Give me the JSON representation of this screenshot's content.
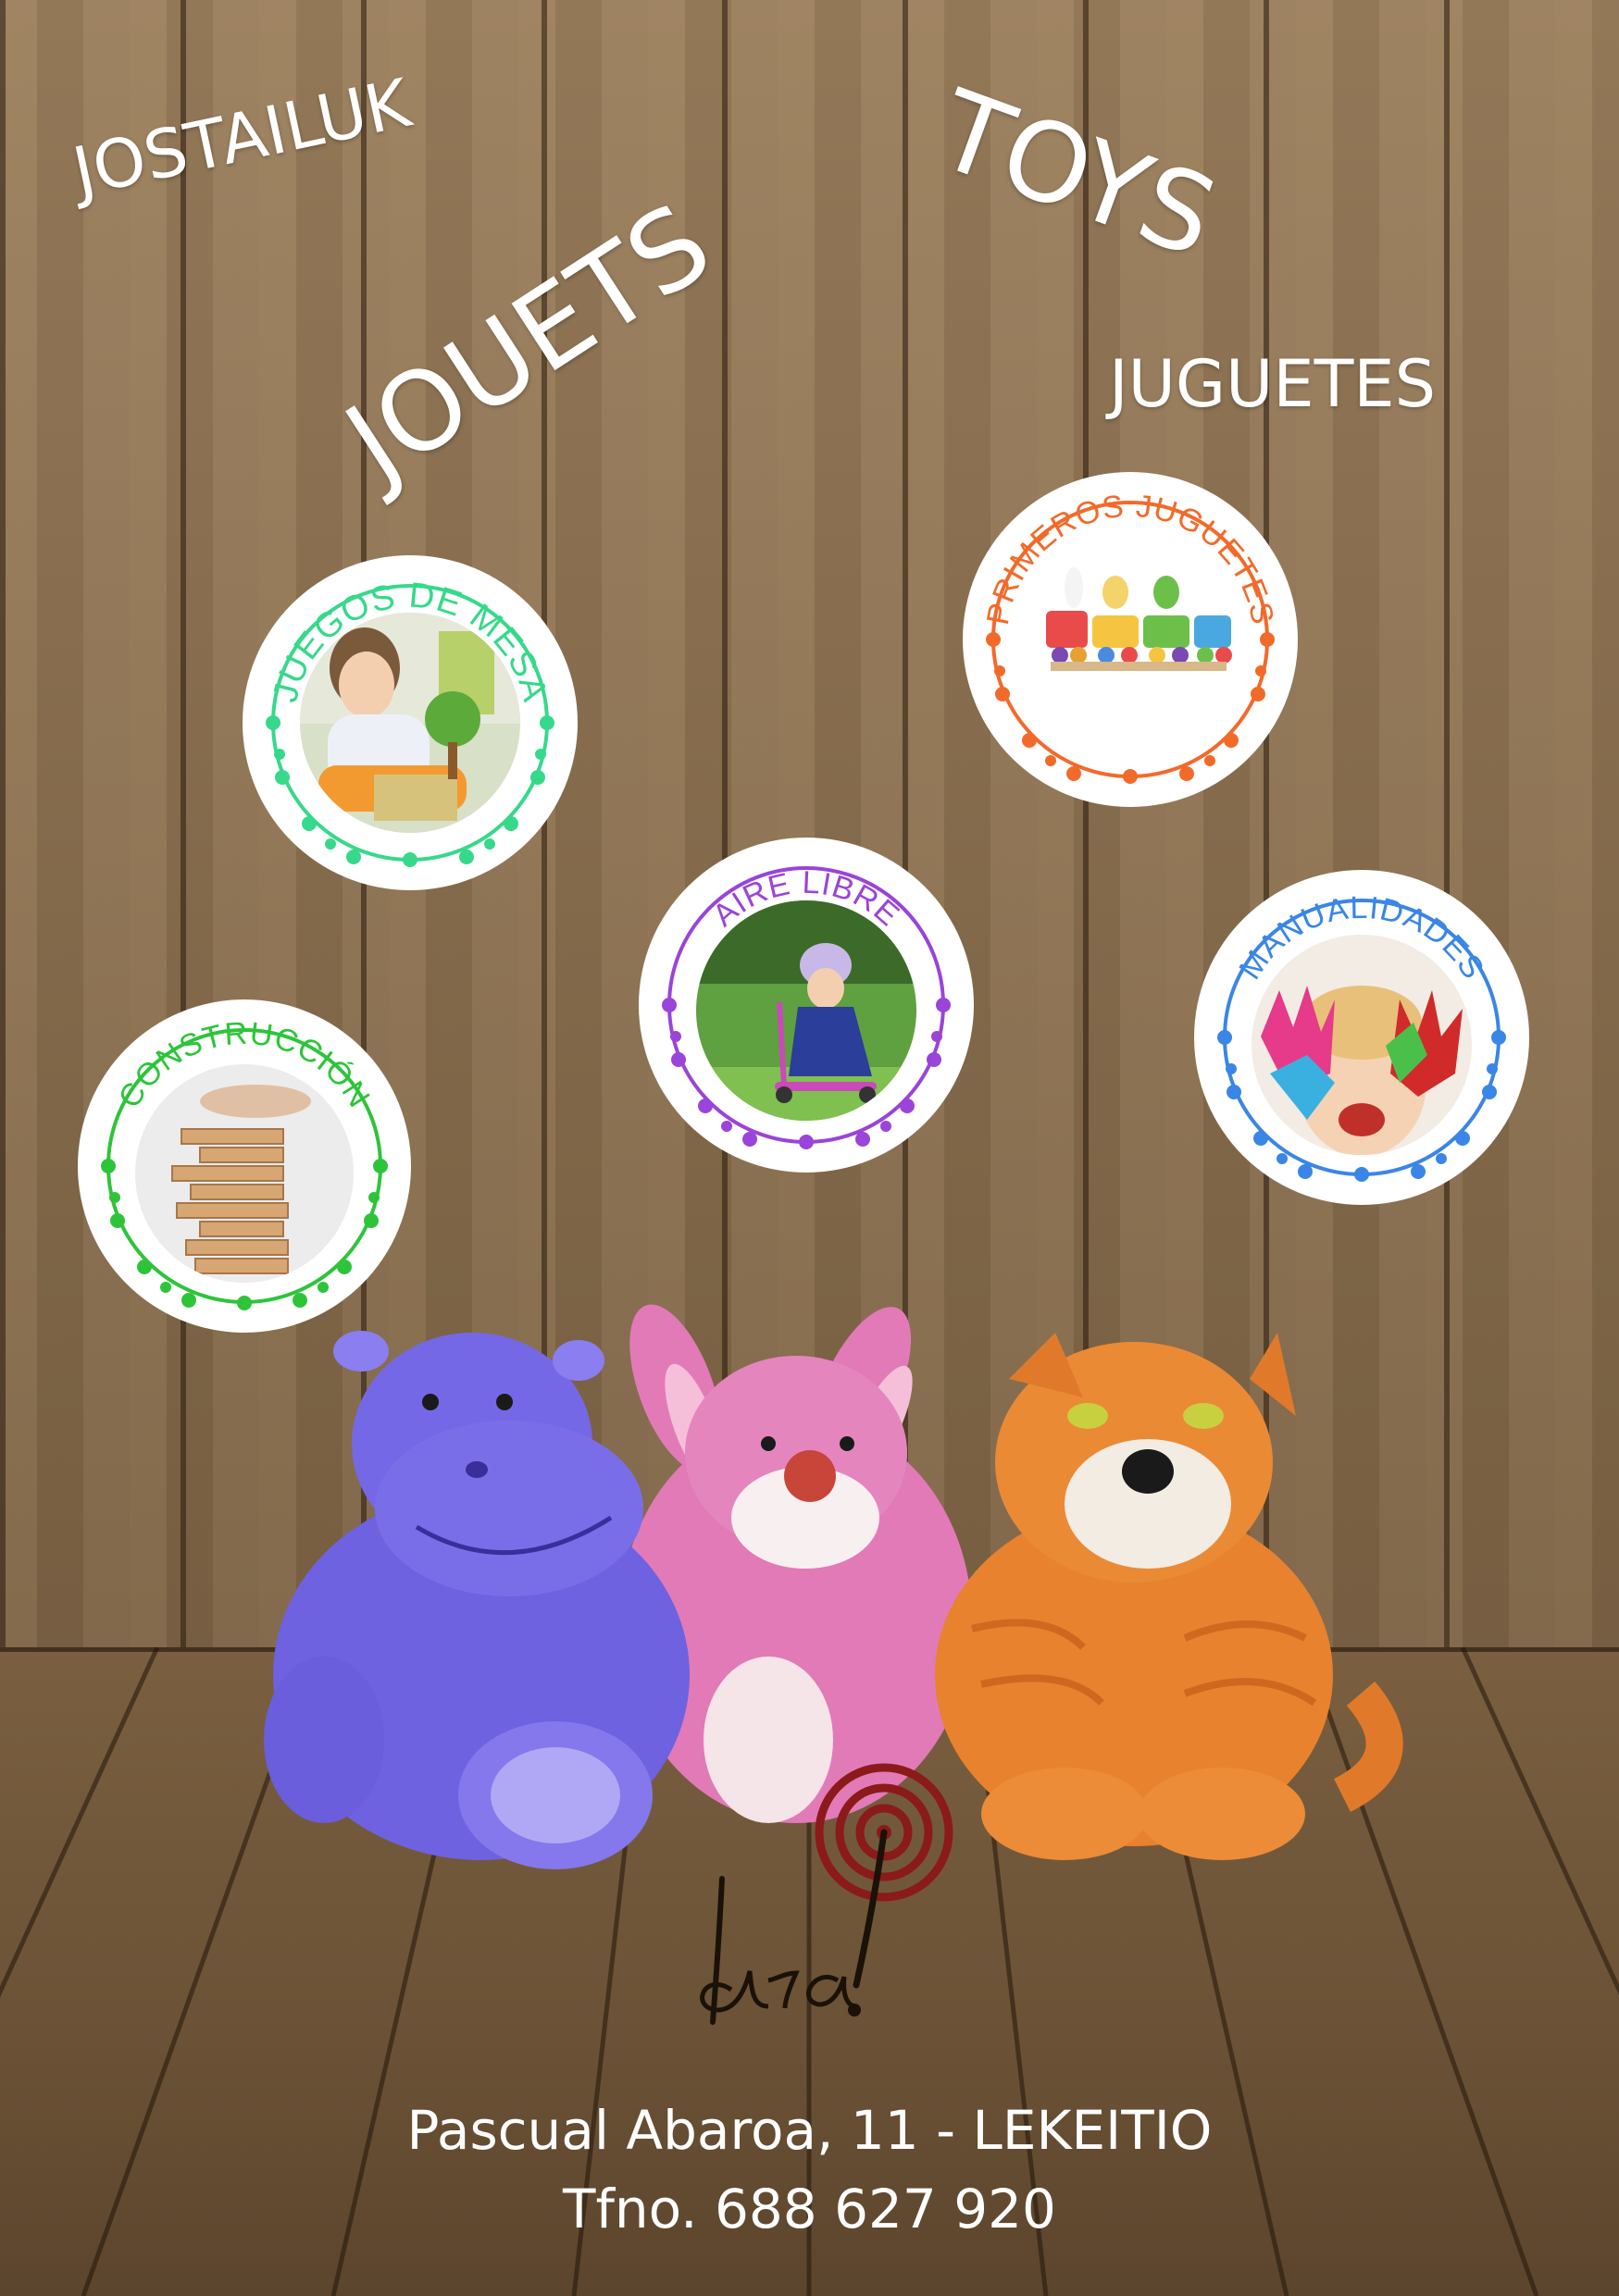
{
  "headline_words": {
    "basque": "JOSTAILUK",
    "french": "JOUETS",
    "english": "TOYS",
    "spanish": "JUGUETES"
  },
  "categories": [
    {
      "label": "JUEGOS DE MESA",
      "color": "#36d98a",
      "photo": "child-playing-board-game"
    },
    {
      "label": "PRIMEROS JUGUETES",
      "color": "#f26a2a",
      "photo": "wooden-toy-train"
    },
    {
      "label": "AIRE LIBRE",
      "color": "#9a44d9",
      "photo": "child-on-scooter"
    },
    {
      "label": "MANUALIDADES",
      "color": "#3a86e6",
      "photo": "child-painted-hands"
    },
    {
      "label": "CONSTRUCCIÓN",
      "color": "#2ec43a",
      "photo": "wooden-block-tower"
    }
  ],
  "plush_toys": [
    "blue-hippo",
    "pink-bunny",
    "orange-cat"
  ],
  "logo": {
    "text": "ara!",
    "color": "#8b1a1a"
  },
  "address": "Pascual Abaroa, 11 - LEKEITIO",
  "phone": "Tfno. 688 627 920",
  "colors": {
    "wood": "#8e7352",
    "text": "#ffffff"
  }
}
